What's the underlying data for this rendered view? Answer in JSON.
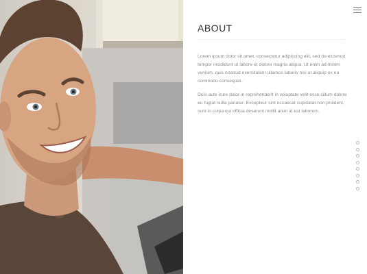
{
  "about": {
    "title": "ABOUT",
    "paragraphs": [
      "Lorem ipsum dolor sit amet, consectetur adipiscing elit, sed do eiusmod tempor incididunt ut labore et dolore magna aliqua. Ut enim ad minim veniam, quis nostrud exercitation ullamco laboris nisi ut aliquip ex ea commodo consequat.",
      "Duis aute irure dolor in reprehenderit in voluptate velit esse cillum dolore eu fugiat nulla pariatur. Excepteur sint occaecat cupidatat non proident, sunt in culpa qui officia deserunt mollit anim id est laborum."
    ]
  },
  "nav": {
    "menu_icon": "hamburger-icon",
    "dot_count": 8
  },
  "colors": {
    "title": "#2f2f2f",
    "body_text": "#8a8a8a",
    "rule": "#eeeeee"
  }
}
